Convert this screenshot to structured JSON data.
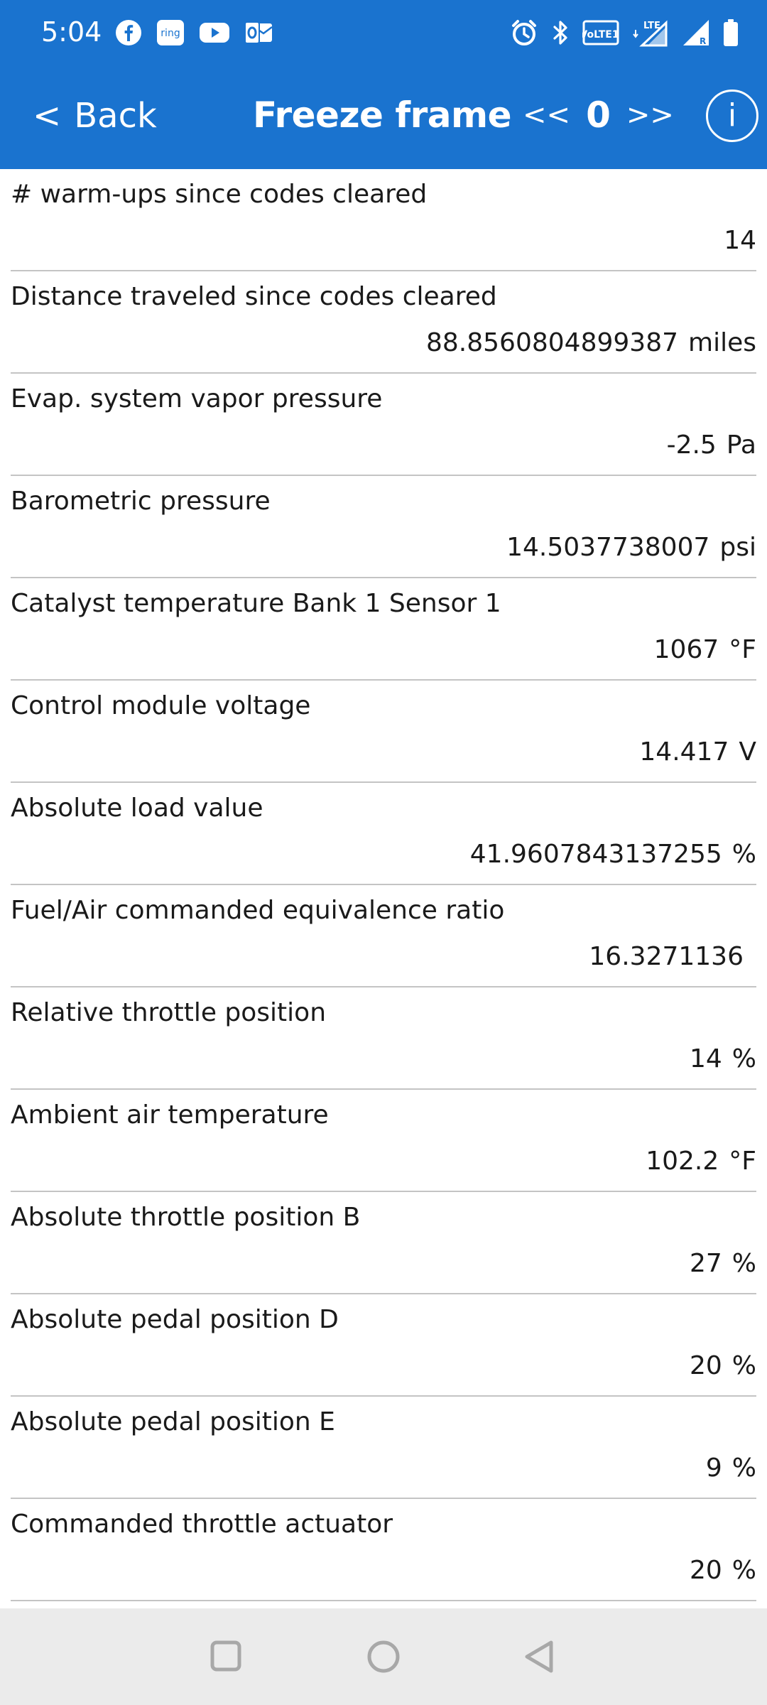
{
  "status_bar": {
    "time": "5:04",
    "left_icons": [
      "facebook-icon",
      "ring-icon",
      "youtube-icon",
      "outlook-icon"
    ],
    "ring_label": "ring",
    "volte_label": "VoLTE1",
    "lte_label": "LTE",
    "roaming_label": "R",
    "right_icons": [
      "alarm-icon",
      "bluetooth-icon",
      "volte-icon",
      "lte-signal-icon",
      "signal-roaming-icon",
      "battery-icon"
    ]
  },
  "app_bar": {
    "back_label": "Back",
    "back_chevron": "<",
    "title": "Freeze frame",
    "prev_label": "<<",
    "frame_number": "0",
    "next_label": ">>",
    "info_label": "i"
  },
  "rows": [
    {
      "label": "# warm-ups since codes cleared",
      "value": "14",
      "unit": ""
    },
    {
      "label": "Distance traveled since codes cleared",
      "value": "88.8560804899387",
      "unit": "miles"
    },
    {
      "label": "Evap. system vapor pressure",
      "value": "-2.5",
      "unit": "Pa"
    },
    {
      "label": "Barometric pressure",
      "value": "14.5037738007",
      "unit": "psi"
    },
    {
      "label": "Catalyst temperature Bank 1 Sensor 1",
      "value": "1067",
      "unit": "°F"
    },
    {
      "label": "Control module voltage",
      "value": "14.417",
      "unit": "V"
    },
    {
      "label": "Absolute load value",
      "value": "41.9607843137255",
      "unit": "%"
    },
    {
      "label": "Fuel/Air commanded equivalence ratio",
      "value": "16.3271136",
      "unit": ""
    },
    {
      "label": "Relative throttle position",
      "value": "14",
      "unit": "%"
    },
    {
      "label": "Ambient air temperature",
      "value": "102.2",
      "unit": "°F"
    },
    {
      "label": "Absolute throttle position B",
      "value": "27",
      "unit": "%"
    },
    {
      "label": "Absolute pedal position D",
      "value": "20",
      "unit": "%"
    },
    {
      "label": "Absolute pedal position E",
      "value": "9",
      "unit": "%"
    },
    {
      "label": "Commanded throttle actuator",
      "value": "20",
      "unit": "%"
    }
  ],
  "nav_bar": {
    "icons": [
      "recents-square-icon",
      "home-circle-icon",
      "back-triangle-icon"
    ]
  },
  "colors": {
    "header_bg": "#1a73cf",
    "header_text": "#ffffff",
    "divider": "#c4c4c4",
    "nav_bg": "#ebebeb",
    "nav_icon": "#a8a8a8"
  }
}
